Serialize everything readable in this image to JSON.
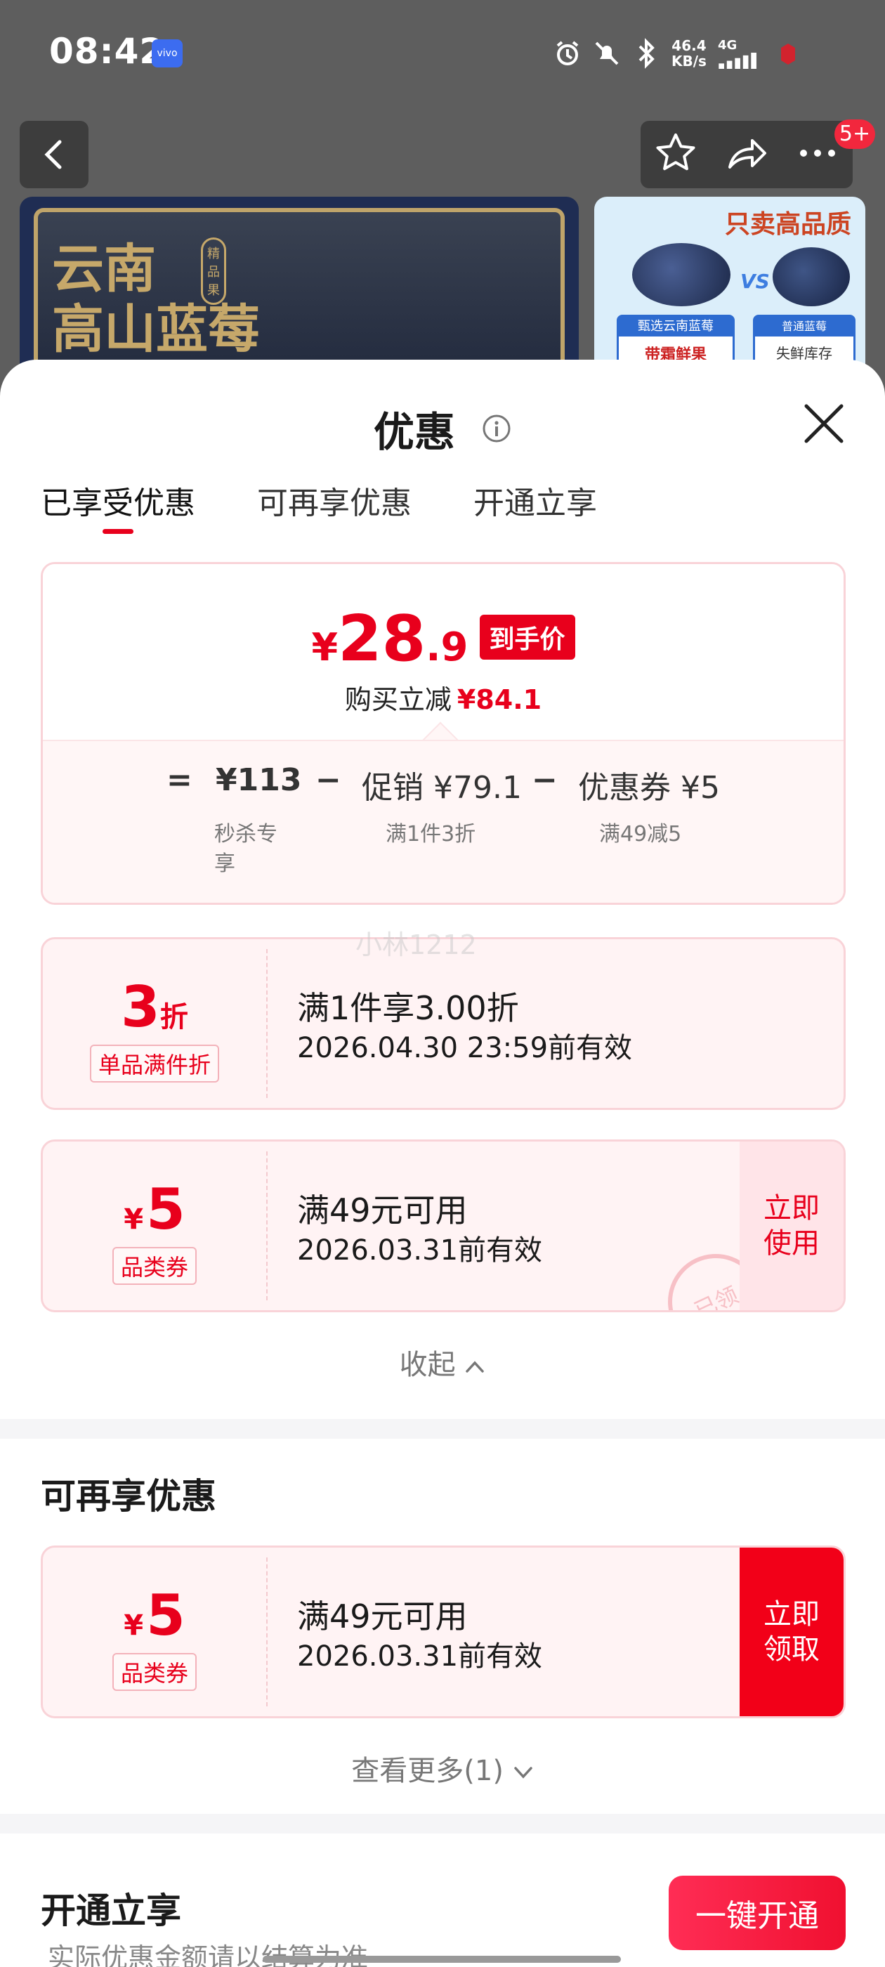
{
  "status_bar": {
    "time": "08:42",
    "brand": "vivo",
    "speed_value": "46.4",
    "speed_unit": "KB/s",
    "network": "4G"
  },
  "nav": {
    "badge": "5+"
  },
  "banner": {
    "left_title_line1": "云南",
    "left_title_line2": "高山蓝莓",
    "left_tag": "精品果",
    "right_title": "只卖高品质",
    "right_vs": "VS",
    "right_card1_header": "甄选云南蓝莓",
    "right_card1_text": "带霜鲜果",
    "right_card2_header": "普通蓝莓",
    "right_card2_text": "失鲜库存"
  },
  "sheet": {
    "title": "优惠",
    "tabs": [
      "已享受优惠",
      "可再享优惠",
      "开通立享"
    ],
    "summary": {
      "currency": "¥",
      "price_int": "28",
      "price_dec": ".9",
      "price_tag": "到手价",
      "saving_label": "购买立减",
      "saving_amount": "¥84.1",
      "equals": "=",
      "base_price": "¥113",
      "base_sub": "秒杀专享",
      "minus1": "−",
      "promo_label": "促销 ¥79.1",
      "promo_sub": "满1件3折",
      "minus2": "−",
      "coupon_label": "优惠券 ¥5",
      "coupon_sub": "满49减5"
    },
    "enjoyed": [
      {
        "value": "3",
        "unit": "折",
        "kind": "单品满件折",
        "title": "满1件享3.00折",
        "valid": "2026.04.30 23:59前有效"
      },
      {
        "currency": "¥",
        "value": "5",
        "kind": "品类券",
        "title": "满49元可用",
        "valid": "2026.03.31前有效",
        "action": "立即使用",
        "stamp": "已领"
      }
    ],
    "collapse_label": "收起",
    "more_section": {
      "title": "可再享优惠",
      "coupon": {
        "currency": "¥",
        "value": "5",
        "kind": "品类券",
        "title": "满49元可用",
        "valid": "2026.03.31前有效",
        "action": "立即领取"
      },
      "more_label": "查看更多(1)"
    },
    "open_section": {
      "title": "开通立享",
      "button": "一键开通",
      "hint": "实际优惠金额请以结算为准"
    },
    "watermark": "小林1212"
  }
}
